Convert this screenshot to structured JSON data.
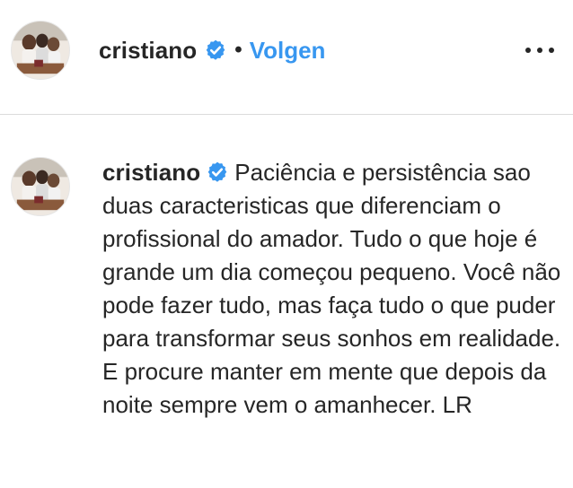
{
  "post_header": {
    "username": "cristiano",
    "separator": "•",
    "follow_label": "Volgen",
    "avatar_icon": "profile-photo-icon",
    "verified_icon": "verified-badge-icon",
    "more_icon": "more-options-icon"
  },
  "caption": {
    "username": "cristiano",
    "text": "Paciência e persistência sao duas caracteristicas que diferenciam o profissional do amador. Tudo o que hoje é grande um dia começou pequeno. Você não pode fazer tudo, mas faça tudo o que puder para transformar seus sonhos em realidade. E procure manter em mente que depois da noite sempre vem o amanhecer. LR"
  },
  "colors": {
    "accent": "#3897f0",
    "text": "#262626",
    "divider": "#dbdbdb"
  }
}
